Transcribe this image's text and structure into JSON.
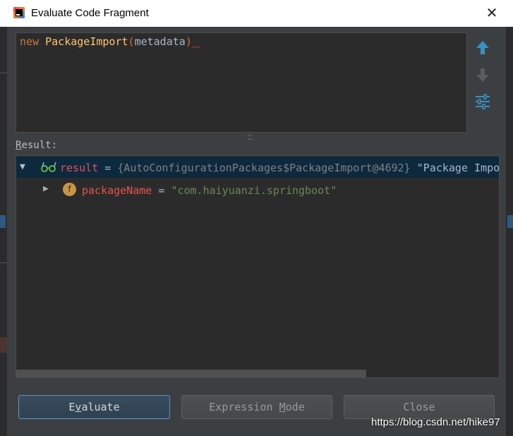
{
  "window": {
    "title": "Evaluate Code Fragment",
    "close_symbol": "✕"
  },
  "editor": {
    "keyword": "new",
    "class_name": "PackageImport",
    "open_paren": "(",
    "argument": "metadata",
    "close_paren": ")"
  },
  "side_buttons": {
    "up_icon": "arrow-up-icon",
    "down_icon": "arrow-down-icon",
    "settings_icon": "settings-icon"
  },
  "result": {
    "label_first": "R",
    "label_rest": "esult:",
    "rows": [
      {
        "name": "result",
        "equals": " = ",
        "type_text": "{AutoConfigurationPackages$PackageImport@4692}",
        "value_text": " \"Package Impo",
        "expanded": true
      },
      {
        "name": "packageName",
        "equals": " = ",
        "value_text": "\"com.haiyuanzi.springboot\"",
        "expanded": false,
        "icon_letter": "f"
      }
    ]
  },
  "buttons": {
    "evaluate_first": "E",
    "evaluate_u": "v",
    "evaluate_rest": "aluate",
    "expression_before": "Expression ",
    "expression_u": "M",
    "expression_after": "ode",
    "close": "Close"
  },
  "watermark": "https://blog.csdn.net/hike97",
  "colors": {
    "dialog_bg": "#3c3f41",
    "editor_bg": "#2b2b2b",
    "keyword": "#cc7832",
    "class": "#ffc66d",
    "string": "#6a8759",
    "field": "#e3544f",
    "selection": "#0d293e",
    "arrow_blue": "#3592c4"
  }
}
